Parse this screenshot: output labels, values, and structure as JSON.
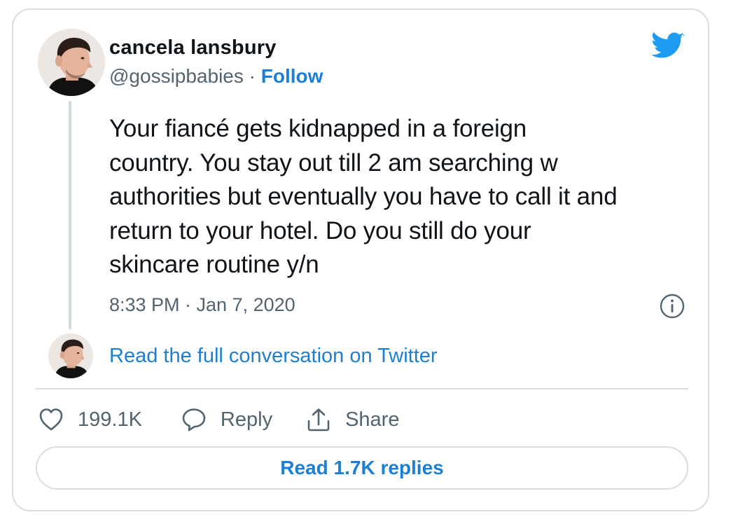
{
  "author": {
    "name": "cancela lansbury",
    "handle": "@gossipbabies",
    "separator": "·",
    "follow_label": "Follow"
  },
  "tweet": {
    "text": "Your fiancé gets kidnapped in a foreign\ncountry. You stay out till 2 am searching w\nauthorities but eventually you have to call it and\nreturn to your hotel. Do you still do your\nskincare routine y/n",
    "timestamp": "8:33 PM · Jan 7, 2020"
  },
  "conversation_link": "Read the full conversation on Twitter",
  "actions": {
    "like_count": "199.1K",
    "reply_label": "Reply",
    "share_label": "Share"
  },
  "replies_button": "Read 1.7K replies",
  "icons": {
    "logo": "twitter-bird-icon",
    "info": "info-icon",
    "like": "heart-icon",
    "reply": "speech-bubble-icon",
    "share": "share-upload-icon"
  },
  "colors": {
    "accent": "#1d7fd4",
    "twitter_blue": "#1d9bf0",
    "muted_text": "#536471",
    "border": "#d8dde1"
  }
}
